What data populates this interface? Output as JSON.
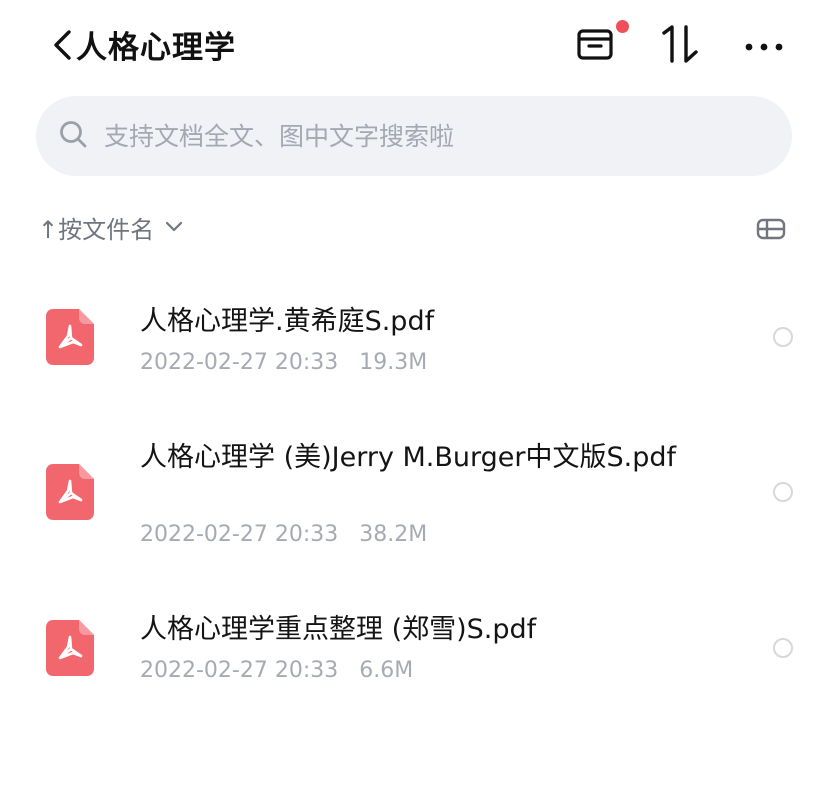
{
  "header": {
    "title": "人格心理学",
    "icons": [
      "chevron-left-icon",
      "archive-box-icon",
      "sort-arrows-icon",
      "more-horizontal-icon"
    ],
    "badge_color": "#f0505a"
  },
  "search": {
    "placeholder": "支持文档全文、图中文字搜索啦"
  },
  "sort": {
    "label": "↑按文件名",
    "arrow": "∨"
  },
  "files": [
    {
      "name": "人格心理学.黄希庭S.pdf",
      "date": "2022-02-27 20:33",
      "size": "19.3M",
      "icon": "pdf-icon"
    },
    {
      "name": "人格心理学 (美)Jerry M.Burger中文版S.pdf",
      "date": "2022-02-27 20:33",
      "size": "38.2M",
      "icon": "pdf-icon"
    },
    {
      "name": "人格心理学重点整理 (郑雪)S.pdf",
      "date": "2022-02-27 20:33",
      "size": "6.6M",
      "icon": "pdf-icon"
    }
  ],
  "colors": {
    "pdf_icon": "#f2666d",
    "meta_text": "#a6aab2",
    "search_bg": "#f0f2f6"
  }
}
